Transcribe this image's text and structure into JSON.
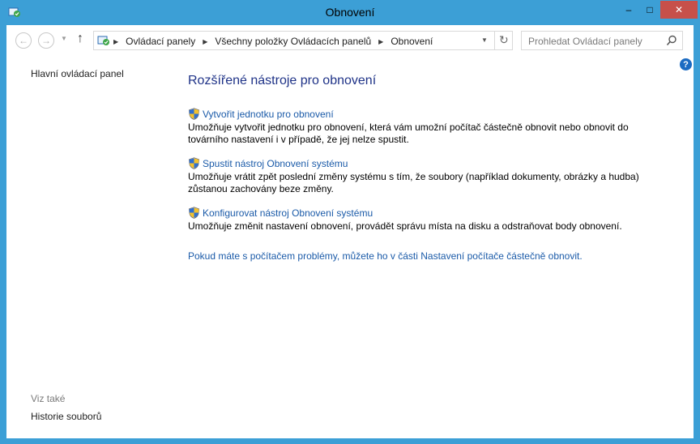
{
  "window": {
    "title": "Obnovení",
    "controls": {
      "minimize": "–",
      "maximize": "□",
      "close": "✕"
    }
  },
  "toolbar": {
    "breadcrumbs": [
      "Ovládací panely",
      "Všechny položky Ovládacích panelů",
      "Obnovení"
    ],
    "search_placeholder": "Prohledat Ovládací panely"
  },
  "sidebar": {
    "home_link": "Hlavní ovládací panel",
    "see_also_label": "Viz také",
    "history_link": "Historie souborů"
  },
  "main": {
    "heading": "Rozšířené nástroje pro obnovení",
    "tools": [
      {
        "title": "Vytvořit jednotku pro obnovení",
        "description": "Umožňuje vytvořit jednotku pro obnovení, která vám umožní počítač částečně obnovit nebo obnovit do továrního nastavení i v případě, že jej nelze spustit."
      },
      {
        "title": "Spustit nástroj Obnovení systému",
        "description": "Umožňuje vrátit zpět poslední změny systému s tím, že soubory (například dokumenty, obrázky a hudba) zůstanou zachovány beze změny."
      },
      {
        "title": "Konfigurovat nástroj Obnovení systému",
        "description": "Umožňuje změnit nastavení obnovení, provádět správu místa na disku a odstraňovat body obnovení."
      }
    ],
    "bottom_link": "Pokud máte s počítačem problémy, můžete ho v části Nastavení počítače částečně obnovit."
  },
  "icons": {
    "app": "control-panel-recovery-icon",
    "shield": "uac-shield-icon",
    "help": "help-icon",
    "search": "search-icon",
    "refresh": "refresh-icon"
  },
  "colors": {
    "titlebar": "#3c9fd6",
    "close_button": "#c7504a",
    "heading": "#1e3287",
    "link": "#1a5aa8"
  }
}
